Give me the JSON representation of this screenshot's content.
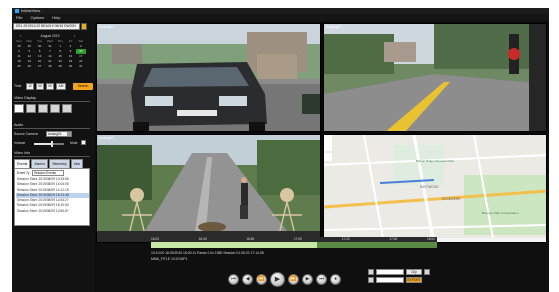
{
  "window": {
    "title": "fvMaxView"
  },
  "menu": [
    "File",
    "Options",
    "Help"
  ],
  "date_field": "DEL 2019/11/10 BEACH/ 06/16 DW20H",
  "calendar": {
    "month_label": "August 2019",
    "weekdays": [
      "Sun",
      "Mon",
      "Tue",
      "Wed",
      "Thu",
      "Fri",
      "Sat"
    ],
    "days": [
      "28",
      "29",
      "30",
      "31",
      "1",
      "2",
      "3",
      "4",
      "5",
      "6",
      "7",
      "8",
      "9",
      "10",
      "11",
      "12",
      "13",
      "14",
      "15",
      "16",
      "17",
      "18",
      "19",
      "20",
      "21",
      "22",
      "23",
      "24",
      "25",
      "26",
      "27",
      "28",
      "29",
      "30",
      "31"
    ],
    "selected_day": "10"
  },
  "time": {
    "label": "Time",
    "h": "12",
    "m": "00",
    "s": "00",
    "ampm": "AM"
  },
  "search_label": "Search",
  "video_display": {
    "title": "Video Display",
    "layout_count": 5,
    "active_index": 0
  },
  "audio": {
    "title": "Audio",
    "source_label": "Source Camera",
    "source_value": "Analog01",
    "volume_label": "Volume",
    "volume_level": 0.6,
    "mute_label": "Mute"
  },
  "video_info": {
    "title": "Video Info",
    "tabs": [
      "Events",
      "Alarms",
      "Telemetry",
      "Infor"
    ],
    "filter_label": "Event Ty",
    "filter_value": "Session Events",
    "events": [
      "Session Start: 2019/08/09 19:33:56",
      "Session Start: 2019/08/09 14:04:05",
      "Session Start: 2019/08/09 14:12:15",
      "Session Start: 2019/08/09 15:13:48",
      "Session Start: 2019/08/09 14:54:27",
      "Session Start: 2019/08/09 16:10:53",
      "Session Start: 2019/08/09 13:50:57"
    ],
    "highlight_index": 3
  },
  "cameras": [
    {
      "label": "Analog01"
    },
    {
      "label": "Analog02"
    },
    {
      "label": "Analog03"
    },
    {
      "label": ""
    }
  ],
  "timeline": {
    "ticks": [
      "16:20",
      "16:40",
      "16:60",
      "17:00",
      "17:20",
      "17:40",
      "18:00"
    ],
    "progress": 0.58
  },
  "status": {
    "line1": "10:10:00          18:09/2019 16:00:11 Pause       0.0x 1980 Session 01:39:22                17:14:38",
    "line2": "MMA_FITLE                                  10:20          MP1"
  },
  "controls": [
    "skip-back",
    "step-back",
    "rewind",
    "play",
    "fast-forward",
    "step-forward",
    "skip-forward",
    "snapshot"
  ],
  "right_controls": {
    "clip_label": "Clip",
    "export_label": "EXPORT"
  },
  "map": {
    "place1": "Bishop Ridge Dinosaur Park",
    "place2": "EASTWOOD",
    "place3": "EDGEMERE",
    "place4": "Bromley Park Conservation",
    "footer": "©2019 Google - Map data ©2019 Terms of Use - Report a map error"
  }
}
